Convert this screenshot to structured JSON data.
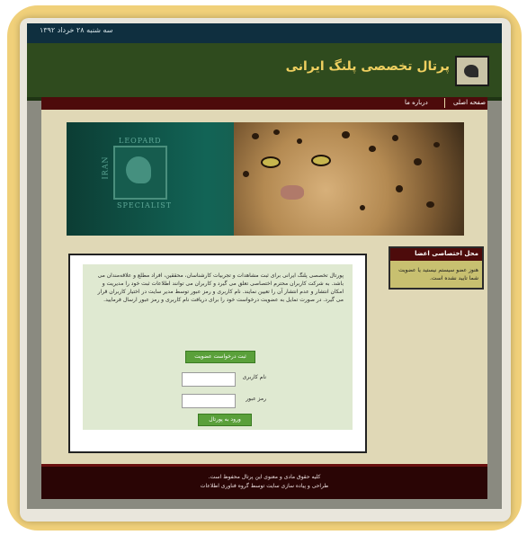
{
  "header": {
    "date": "سه شنبه ۲۸ خرداد ۱۳۹۲",
    "site_title": "پرتال تخصصی پلنگ ایرانی",
    "logo_icon": "leopard-head-logo-icon"
  },
  "nav": {
    "items": [
      {
        "label": "صفحه اصلی"
      },
      {
        "label": "درباره ما"
      }
    ]
  },
  "banner": {
    "image": "persian-leopard-banner",
    "words": [
      "LEOPARD",
      "IRAN",
      "SPECIALIST"
    ]
  },
  "sidebar": {
    "title": "محل اختصاصی اعضا",
    "text": "هنوز عضو سیستم نیستید یا عضویت شما تایید نشده است."
  },
  "main": {
    "intro": "پورتال تخصصی پلنگ ایرانی برای ثبت مشاهدات و تجربیات کارشناسان، محققین، افراد مطلع و علاقه‌مندان می باشد. به شرکت کاربران محترم اختصاصی تعلق می گیرد و کاربران می توانند اطلاعات ثبت خود را مدیریت و امکان انتشار و عدم انتشار آن را تعیین نمایند. نام کاربری و رمز عبور توسط مدیر سایت در اختیار کاربران قرار می گیرد. در صورت تمایل به عضویت درخواست خود را برای دریافت نام کاربری و رمز عبور ارسال فرمایید.",
    "membership_button": "ثبت درخواست عضویت",
    "username_label": "نام کاربری",
    "password_label": "رمز عبور",
    "login_button": "ورود به پورتال",
    "username_value": "",
    "password_value": ""
  },
  "footer": {
    "line1": "کلیه حقوق مادی و معنوی این پرتال محفوظ است.",
    "line2": "طراحی و پیاده سازی سایت توسط گروه فناوری اطلاعات"
  },
  "colors": {
    "frame": "#f0d07a",
    "top_strip": "#0f2f3f",
    "header": "#2f4b1e",
    "nav": "#4d0b0b",
    "content": "#e0d8b6",
    "button": "#5aa03a",
    "footer": "#2a0505"
  }
}
